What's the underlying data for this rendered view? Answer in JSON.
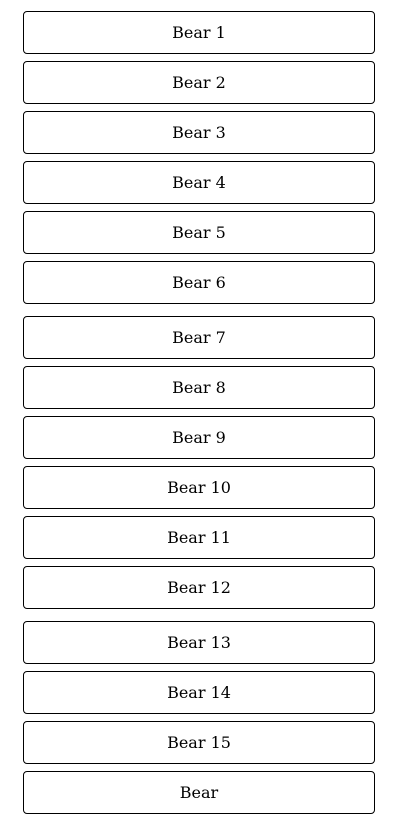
{
  "buttons": [
    {
      "label": "Bear 1"
    },
    {
      "label": "Bear 2"
    },
    {
      "label": "Bear 3"
    },
    {
      "label": "Bear 4"
    },
    {
      "label": "Bear 5"
    },
    {
      "label": "Bear 6"
    },
    {
      "label": "Bear 7"
    },
    {
      "label": "Bear 8"
    },
    {
      "label": "Bear 9"
    },
    {
      "label": "Bear 10"
    },
    {
      "label": "Bear 11"
    },
    {
      "label": "Bear 12"
    },
    {
      "label": "Bear 13"
    },
    {
      "label": "Bear 14"
    },
    {
      "label": "Bear 15"
    },
    {
      "label": "Bear"
    }
  ]
}
